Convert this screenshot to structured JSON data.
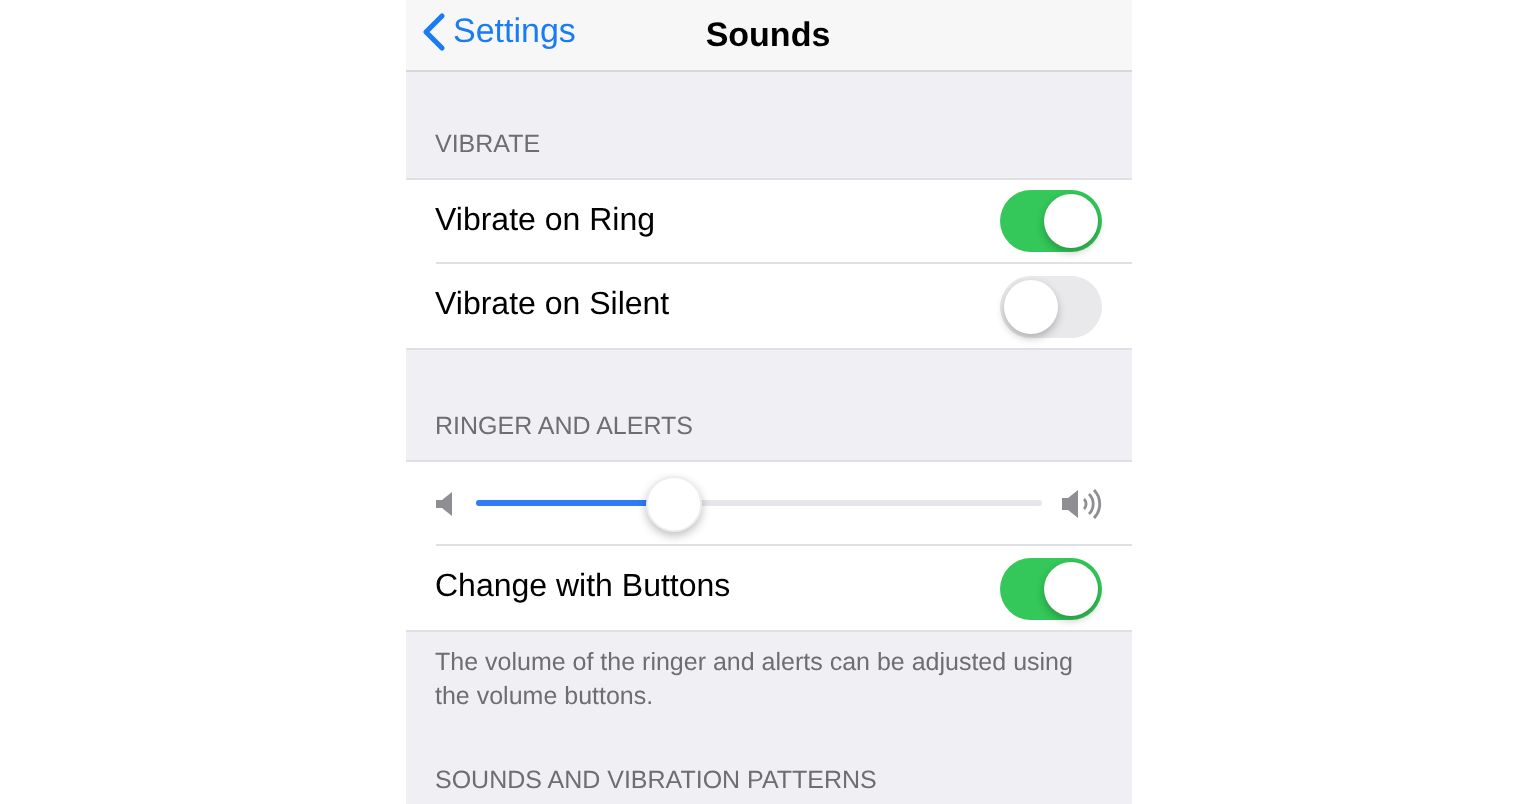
{
  "nav": {
    "back": "Settings",
    "title": "Sounds"
  },
  "sections": [
    {
      "header": "VIBRATE",
      "rows": [
        {
          "kind": "toggle",
          "label": "Vibrate on Ring",
          "on": true
        },
        {
          "kind": "toggle",
          "label": "Vibrate on Silent",
          "on": false
        }
      ]
    },
    {
      "header": "RINGER AND ALERTS",
      "rows": [
        {
          "kind": "slider",
          "level": 0.35
        },
        {
          "kind": "toggle",
          "label": "Change with Buttons",
          "on": true
        }
      ],
      "footer": "The volume of the ringer and alerts can be adjusted using the volume buttons."
    },
    {
      "header": "SOUNDS AND VIBRATION PATTERNS"
    }
  ]
}
